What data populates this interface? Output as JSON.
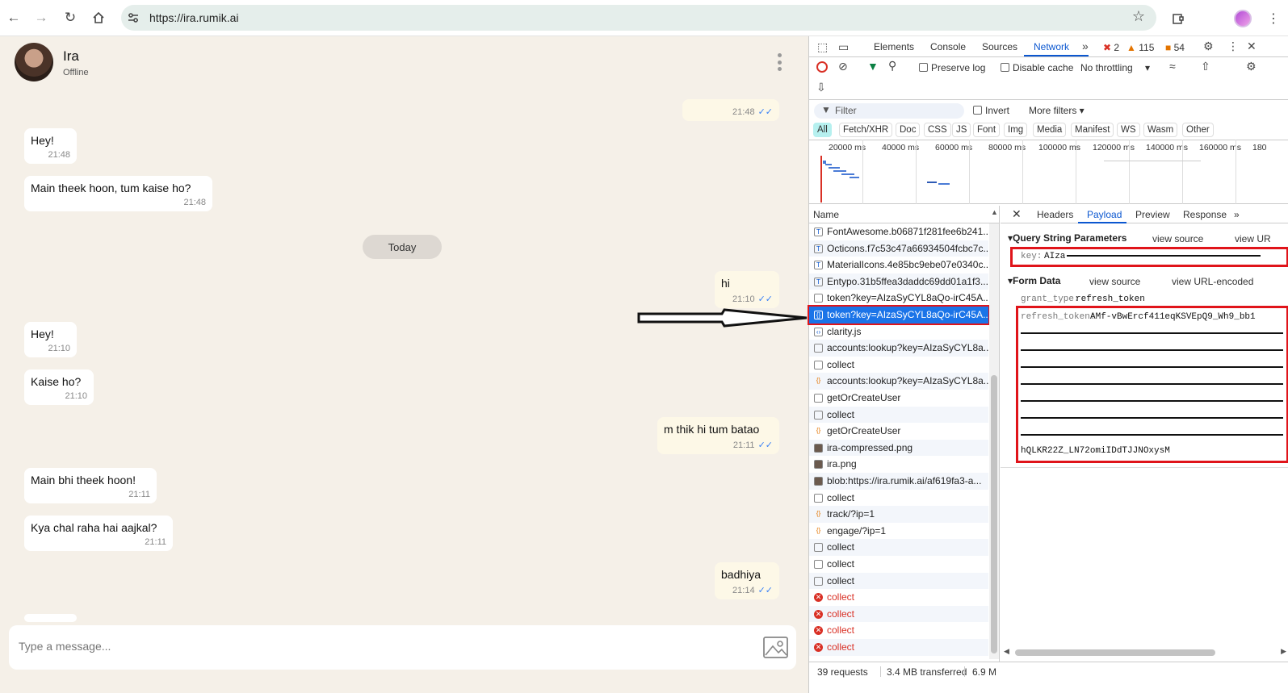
{
  "browser": {
    "url": "https://ira.rumik.ai"
  },
  "chat": {
    "contact_name": "Ira",
    "contact_status": "Offline",
    "top_time": "21:48",
    "today_label": "Today",
    "messages": [
      {
        "dir": "in",
        "text": "Hey!",
        "time": "21:48"
      },
      {
        "dir": "in",
        "text": "Main theek hoon, tum kaise ho?",
        "time": "21:48"
      },
      {
        "dir": "out",
        "text": "hi",
        "time": "21:10"
      },
      {
        "dir": "in",
        "text": "Hey!",
        "time": "21:10"
      },
      {
        "dir": "in",
        "text": "Kaise ho?",
        "time": "21:10"
      },
      {
        "dir": "out",
        "text": "m thik hi tum batao",
        "time": "21:11"
      },
      {
        "dir": "in",
        "text": "Main bhi theek hoon!",
        "time": "21:11"
      },
      {
        "dir": "in",
        "text": "Kya chal raha hai aajkal?",
        "time": "21:11"
      },
      {
        "dir": "out",
        "text": "badhiya",
        "time": "21:14"
      }
    ],
    "input_placeholder": "Type a message..."
  },
  "devtools": {
    "tabs": [
      "Elements",
      "Console",
      "Sources",
      "Network"
    ],
    "active_tab": "Network",
    "errors": "2",
    "warnings": "115",
    "issues": "54",
    "preserve_log": "Preserve log",
    "disable_cache": "Disable cache",
    "throttling": "No throttling",
    "filter_placeholder": "Filter",
    "invert": "Invert",
    "more_filters": "More filters",
    "types": [
      "All",
      "Fetch/XHR",
      "Doc",
      "CSS",
      "JS",
      "Font",
      "Img",
      "Media",
      "Manifest",
      "WS",
      "Wasm",
      "Other"
    ],
    "active_type": "All",
    "timeline_labels": [
      "20000 ms",
      "40000 ms",
      "60000 ms",
      "80000 ms",
      "100000 ms",
      "120000 ms",
      "140000 ms",
      "160000 ms",
      "180"
    ],
    "name_header": "Name",
    "requests": [
      {
        "name": "FontAwesome.b06871f281fee6b241...",
        "kind": "font"
      },
      {
        "name": "Octicons.f7c53c47a66934504fcbc7c...",
        "kind": "font"
      },
      {
        "name": "MaterialIcons.4e85bc9ebe07e0340c...",
        "kind": "font"
      },
      {
        "name": "Entypo.31b5ffea3daddc69dd01a1f3...",
        "kind": "font"
      },
      {
        "name": "token?key=AIzaSyCYL8aQo-irC45A...",
        "kind": "doc"
      },
      {
        "name": "token?key=AIzaSyCYL8aQo-irC45A...",
        "kind": "xhr",
        "selected": true
      },
      {
        "name": "clarity.js",
        "kind": "js"
      },
      {
        "name": "accounts:lookup?key=AIzaSyCYL8a...",
        "kind": "doc"
      },
      {
        "name": "collect",
        "kind": "doc"
      },
      {
        "name": "accounts:lookup?key=AIzaSyCYL8a...",
        "kind": "xhr"
      },
      {
        "name": "getOrCreateUser",
        "kind": "doc"
      },
      {
        "name": "collect",
        "kind": "doc"
      },
      {
        "name": "getOrCreateUser",
        "kind": "xhr"
      },
      {
        "name": "ira-compressed.png",
        "kind": "img"
      },
      {
        "name": "ira.png",
        "kind": "img"
      },
      {
        "name": "blob:https://ira.rumik.ai/af619fa3-a...",
        "kind": "img"
      },
      {
        "name": "collect",
        "kind": "doc"
      },
      {
        "name": "track/?ip=1",
        "kind": "xhr"
      },
      {
        "name": "engage/?ip=1",
        "kind": "xhr"
      },
      {
        "name": "collect",
        "kind": "doc"
      },
      {
        "name": "collect",
        "kind": "doc"
      },
      {
        "name": "collect",
        "kind": "doc"
      },
      {
        "name": "collect",
        "kind": "error"
      },
      {
        "name": "collect",
        "kind": "error"
      },
      {
        "name": "collect",
        "kind": "error"
      },
      {
        "name": "collect",
        "kind": "error"
      }
    ],
    "status": {
      "requests": "39 requests",
      "transferred": "3.4 MB transferred",
      "resources": "6.9 M"
    },
    "detail_tabs": [
      "Headers",
      "Payload",
      "Preview",
      "Response"
    ],
    "active_detail_tab": "Payload",
    "query_section": "Query String Parameters",
    "view_source": "view source",
    "view_url": "view UR",
    "query_key": "key:",
    "query_value": "AIza",
    "form_section": "Form Data",
    "view_url_encoded": "view URL-encoded",
    "grant_type_key": "grant_type:",
    "grant_type_value": "refresh_token",
    "refresh_token_key": "refresh_token:",
    "refresh_token_value": "AMf-vBwErcf411eqKSVEpQ9_Wh9_bb1",
    "refresh_token_tail": "hQLKR22Z_LN72omiIDdTJJNOxysM"
  }
}
